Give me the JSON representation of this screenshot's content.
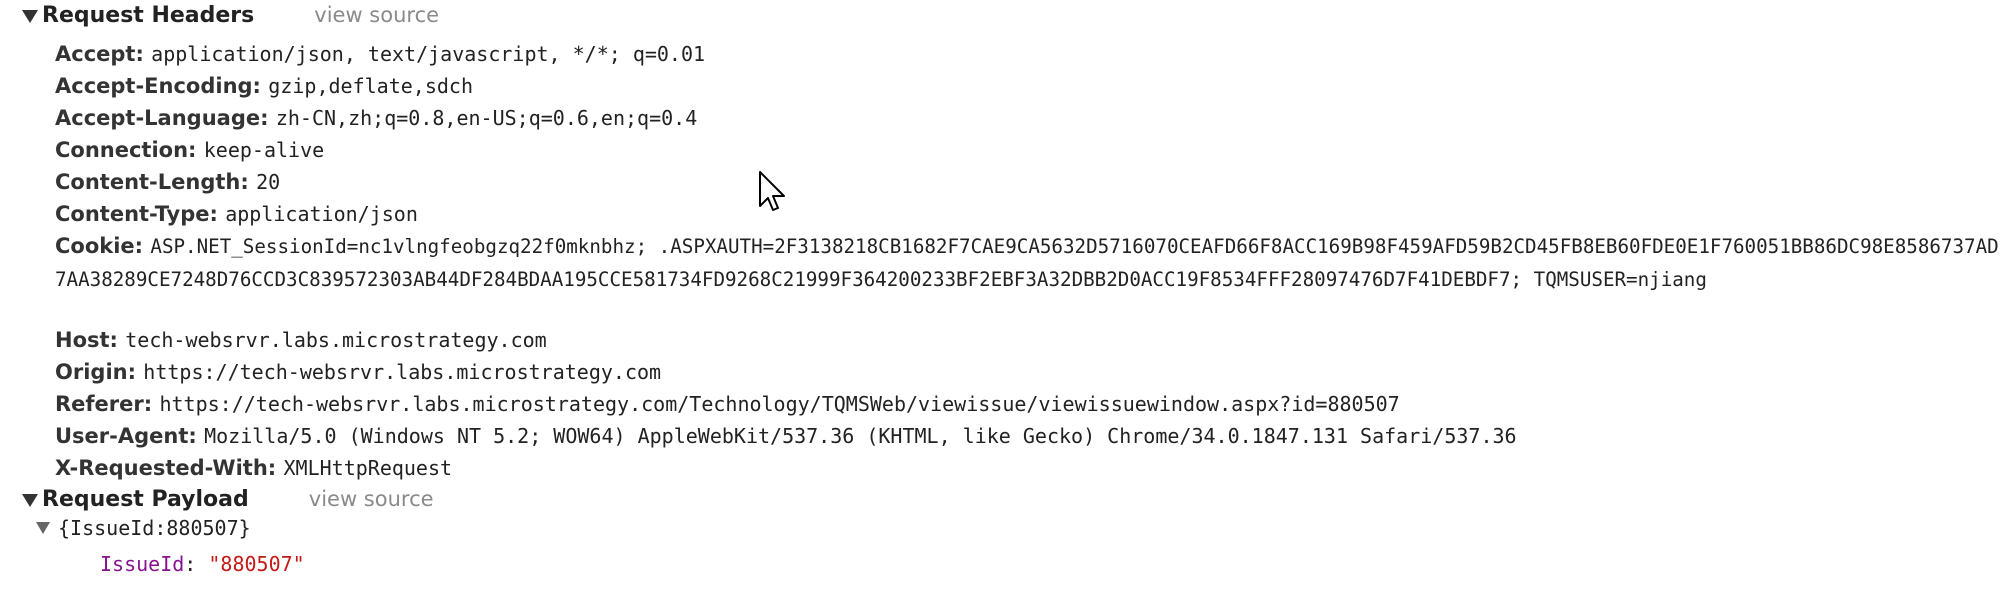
{
  "request_headers": {
    "title": "Request Headers",
    "view_source": "view source",
    "rows": [
      {
        "key": "Accept:",
        "value": "application/json, text/javascript, */*; q=0.01"
      },
      {
        "key": "Accept-Encoding:",
        "value": "gzip,deflate,sdch"
      },
      {
        "key": "Accept-Language:",
        "value": "zh-CN,zh;q=0.8,en-US;q=0.6,en;q=0.4"
      },
      {
        "key": "Connection:",
        "value": "keep-alive"
      },
      {
        "key": "Content-Length:",
        "value": "20"
      },
      {
        "key": "Content-Type:",
        "value": "application/json"
      },
      {
        "key": "Cookie:",
        "value": "ASP.NET_SessionId=nc1vlngfeobgzq22f0mknbhz; .ASPXAUTH=2F3138218CB1682F7CAE9CA5632D5716070CEAFD66F8ACC169B98F459AFD59B2CD45FB8EB60FDE0E1F760051BB86DC98E8586737AD7AA38289CE7248D76CCD3C839572303AB44DF284BDAA195CCE581734FD9268C21999F364200233BF2EBF3A32DBB2D0ACC19F8534FFF28097476D7F41DEBDF7; TQMSUSER=njiang"
      },
      {
        "key": "Host:",
        "value": "tech-websrvr.labs.microstrategy.com"
      },
      {
        "key": "Origin:",
        "value": "https://tech-websrvr.labs.microstrategy.com"
      },
      {
        "key": "Referer:",
        "value": "https://tech-websrvr.labs.microstrategy.com/Technology/TQMSWeb/viewissue/viewissuewindow.aspx?id=880507"
      },
      {
        "key": "User-Agent:",
        "value": "Mozilla/5.0 (Windows NT 5.2; WOW64) AppleWebKit/537.36 (KHTML, like Gecko) Chrome/34.0.1847.131 Safari/537.36"
      },
      {
        "key": "X-Requested-With:",
        "value": "XMLHttpRequest"
      }
    ]
  },
  "request_payload": {
    "title": "Request Payload",
    "view_source": "view source",
    "object_label": "{IssueId:880507}",
    "property_key": "IssueId",
    "property_sep": ": ",
    "property_value": "\"880507\""
  },
  "colors": {
    "property_key": "#881391",
    "string_value": "#c41a16",
    "muted_link": "#8a8a8a"
  },
  "icons": {
    "section_toggle": "triangle-down-icon",
    "cursor": "mouse-pointer-icon"
  }
}
